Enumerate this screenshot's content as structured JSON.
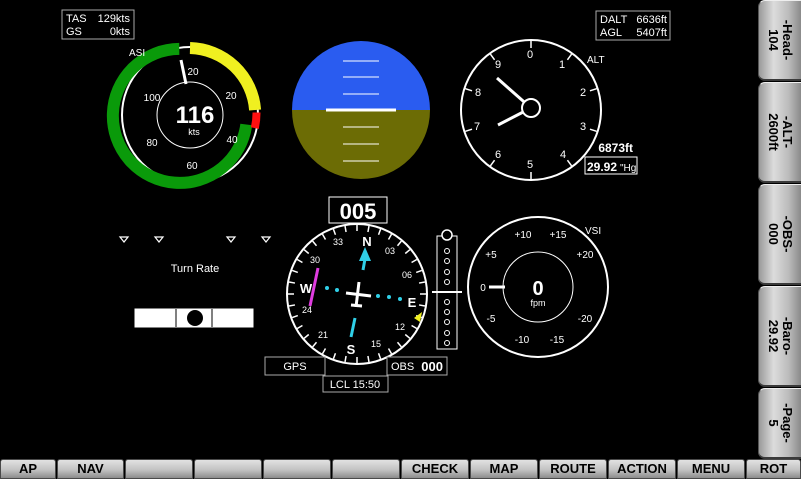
{
  "tas": {
    "label": "TAS",
    "value": "129kts"
  },
  "gs": {
    "label": "GS",
    "value": "0kts"
  },
  "dalt": {
    "label": "DALT",
    "value": "6636ft"
  },
  "agl": {
    "label": "AGL",
    "value": "5407ft"
  },
  "asi": {
    "label": "ASI",
    "value": "116",
    "unit": "kts",
    "scale": [
      "20",
      "20",
      "40",
      "60",
      "80",
      "100"
    ]
  },
  "alt": {
    "label": "ALT",
    "value": "6873ft",
    "baro": "29.92",
    "baro_unit": "\"Hg",
    "dial": [
      "0",
      "1",
      "2",
      "3",
      "4",
      "5",
      "6",
      "7",
      "8",
      "9"
    ]
  },
  "heading": {
    "value": "005",
    "labels": {
      "n": "N",
      "e": "E",
      "s": "S",
      "w": "W",
      "t33": "33",
      "t30": "30",
      "t24": "24",
      "t21": "21",
      "t15": "15",
      "t12": "12",
      "t06": "06",
      "t03": "03"
    }
  },
  "turn": {
    "label": "Turn Rate"
  },
  "vsi": {
    "label": "VSI",
    "value": "0",
    "unit": "fpm",
    "scale": [
      "+10",
      "+15",
      "+20",
      "+5",
      "0",
      "-5",
      "-20",
      "-10",
      "-15"
    ]
  },
  "gps": {
    "label": "GPS"
  },
  "obs": {
    "label": "OBS",
    "value": "000"
  },
  "clock": {
    "label": "LCL 15:50"
  },
  "side_buttons": [
    {
      "label": "-Head-\n104"
    },
    {
      "label": "-ALT-\n2600ft"
    },
    {
      "label": "-OBS-\n000"
    },
    {
      "label": "-Baro-\n29.92"
    },
    {
      "label": "-Page-\n5"
    }
  ],
  "bottom_buttons": [
    {
      "label": "AP"
    },
    {
      "label": "NAV"
    },
    {
      "label": ""
    },
    {
      "label": ""
    },
    {
      "label": ""
    },
    {
      "label": ""
    },
    {
      "label": "CHECK"
    },
    {
      "label": "MAP"
    },
    {
      "label": "ROUTE"
    },
    {
      "label": "ACTION"
    },
    {
      "label": "MENU"
    },
    {
      "label": "ROT"
    }
  ],
  "colors": {
    "sky": "#2a5cf0",
    "ground": "#6c6c05",
    "green": "#0a9a0a",
    "yellow": "#f0f020",
    "red": "#ff1010",
    "magenta": "#e03ce0",
    "cyan": "#30d0e8"
  }
}
